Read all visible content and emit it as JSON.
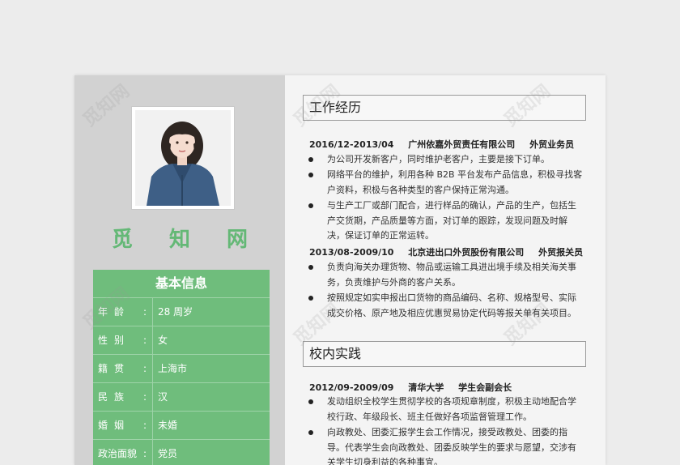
{
  "profile": {
    "name": "觅 知 网"
  },
  "basic_info": {
    "title": "基本信息",
    "rows": [
      {
        "label": "年龄",
        "value": "28 周岁"
      },
      {
        "label": "性别",
        "value": "女"
      },
      {
        "label": "籍贯",
        "value": "上海市"
      },
      {
        "label": "民族",
        "value": "汉"
      },
      {
        "label": "婚姻",
        "value": "未婚"
      },
      {
        "label": "政治面貌",
        "value": "党员"
      }
    ]
  },
  "work": {
    "title": "工作经历",
    "jobs": [
      {
        "period": "2016/12-2013/04",
        "company": "广州依嘉外贸责任有限公司",
        "role": "外贸业务员",
        "bullets": [
          "为公司开发新客户，同时维护老客户，主要是接下订单。",
          "网络平台的维护，利用各种 B2B 平台发布产品信息，积极寻找客户资料，积极与各种类型的客户保持正常沟通。",
          "与生产工厂或部门配合，进行样品的确认，产品的生产，包括生产交货期，产品质量等方面，对订单的跟踪，发现问题及时解决，保证订单的正常运转。"
        ]
      },
      {
        "period": "2013/08-2009/10",
        "company": "北京进出口外贸股份有限公司",
        "role": "外贸报关员",
        "bullets": [
          "负责向海关办理货物、物品或运输工具进出境手续及相关海关事务，负责维护与外商的客户关系。",
          "按照规定如实申报出口货物的商品编码、名称、规格型号、实际成交价格、原产地及相应优惠贸易协定代码等报关单有关项目。"
        ]
      }
    ]
  },
  "campus": {
    "title": "校内实践",
    "items": [
      {
        "period": "2012/09-2009/09",
        "school": "清华大学",
        "role": "学生会副会长",
        "bullets": [
          "发动组织全校学生贯彻学校的各项规章制度，积极主动地配合学校行政、年级段长、班主任做好各项监督管理工作。",
          "向政教处、团委汇报学生会工作情况，接受政教处、团委的指导。代表学生会向政教处、团委反映学生的要求与愿望，交涉有关学生切身利益的各种事宜。"
        ]
      }
    ]
  },
  "watermark": {
    "text": "觅知网"
  },
  "colors": {
    "accent_green": "#6fbd7c",
    "name_green": "#64b876",
    "left_bg": "#d2d2d2",
    "right_bg": "#f4f4f4"
  }
}
